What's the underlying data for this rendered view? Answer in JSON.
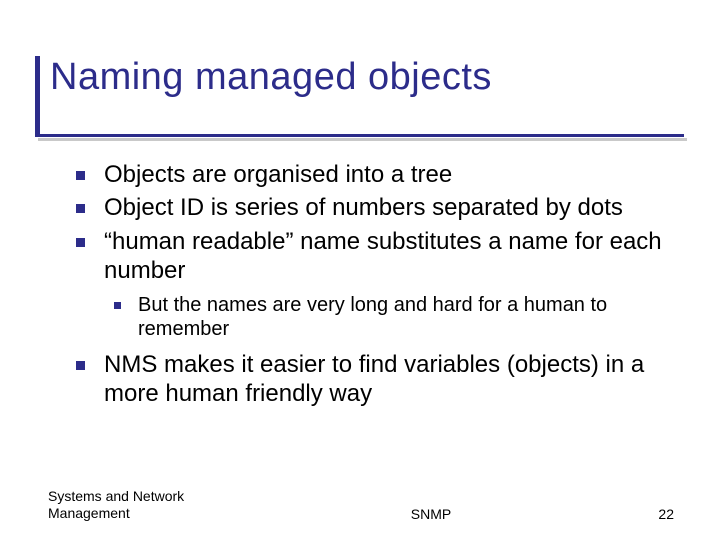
{
  "title": "Naming managed objects",
  "bullets": {
    "b0": "Objects are organised into a tree",
    "b1": "Object ID is series of numbers separated by dots",
    "b2": "“human readable” name substitutes a name for each number",
    "b2_sub0": "But the names are very long and hard for a human to remember",
    "b3": "NMS makes it easier to find variables (objects) in a more human friendly way"
  },
  "footer": {
    "left": "Systems and Network Management",
    "center": "SNMP",
    "page": "22"
  }
}
